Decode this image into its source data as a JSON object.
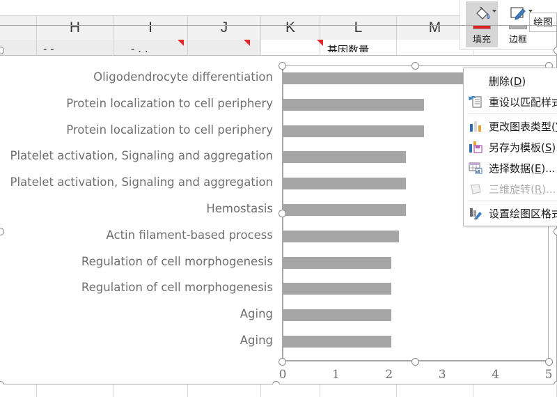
{
  "spreadsheet": {
    "column_headers": [
      "H",
      "I",
      "J",
      "K",
      "L",
      "M"
    ],
    "clipped_cell_text_left": "- -",
    "clipped_cell_text_mid": "- , ,",
    "clipped_cell_text_right": "基因数量"
  },
  "ribbon": {
    "group_label": "绘图",
    "fill_label": "填充",
    "fill_color": "#e02020",
    "border_label": "边框",
    "border_color": "#b0b0b0"
  },
  "context_menu": {
    "items": [
      {
        "label": "删除(D)",
        "accel": "D",
        "icon": "",
        "disabled": false
      },
      {
        "label": "重设以匹配样式(A)",
        "accel": "A",
        "icon": "reset-style-icon",
        "disabled": false
      },
      {
        "label": "更改图表类型(Y)...",
        "accel": "Y",
        "icon": "chart-type-icon",
        "disabled": false
      },
      {
        "label": "另存为模板(S)...",
        "accel": "S",
        "icon": "save-template-icon",
        "disabled": false
      },
      {
        "label": "选择数据(E)...",
        "accel": "E",
        "icon": "select-data-icon",
        "disabled": false
      },
      {
        "label": "三维旋转(R)...",
        "accel": "R",
        "icon": "rotate-3d-icon",
        "disabled": true
      },
      {
        "label": "设置绘图区格式(F)...",
        "accel": "F",
        "icon": "format-plot-area-icon",
        "disabled": false
      }
    ]
  },
  "chart_data": {
    "type": "bar",
    "orientation": "horizontal",
    "title": "",
    "xlabel": "",
    "ylabel": "",
    "xlim": [
      0,
      5
    ],
    "xticks": [
      "0",
      "1",
      "2",
      "3",
      "4",
      "5"
    ],
    "grid": false,
    "legend": "none",
    "bar_color": "#a6a6a6",
    "categories": [
      "Oligodendrocyte differentiation",
      "Protein localization to cell periphery",
      "Protein localization to cell periphery",
      "Platelet activation, Signaling and aggregation",
      "Platelet activation, Signaling and aggregation",
      "Hemostasis",
      "Actin filament-based process",
      "Regulation of cell morphogenesis",
      "Regulation of cell morphogenesis",
      "Aging",
      "Aging"
    ],
    "values": [
      3.38,
      2.64,
      2.64,
      2.3,
      2.3,
      2.3,
      2.17,
      2.03,
      2.03,
      2.03,
      2.03
    ]
  }
}
